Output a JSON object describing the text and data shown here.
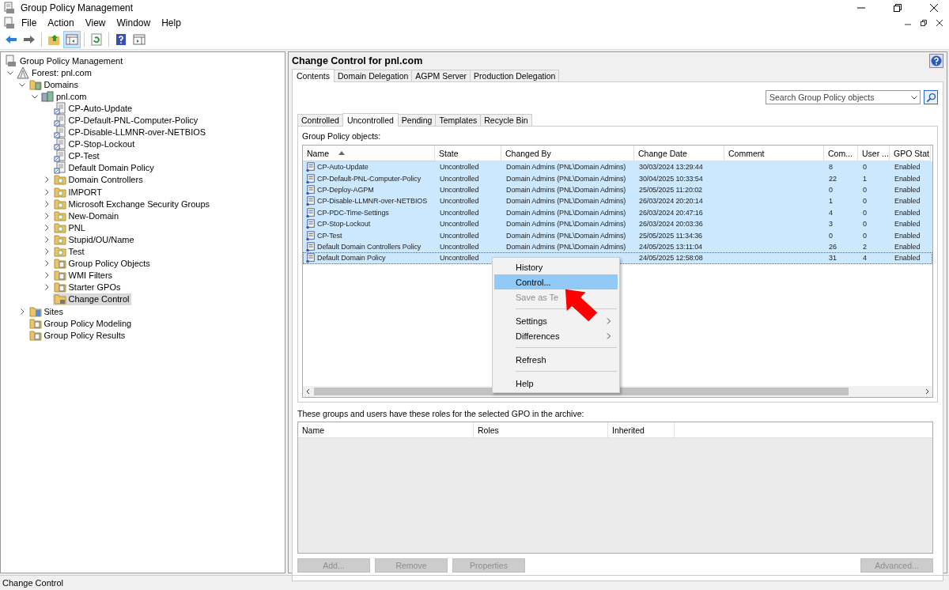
{
  "window": {
    "title": "Group Policy Management"
  },
  "menu": [
    "File",
    "Action",
    "View",
    "Window",
    "Help"
  ],
  "toolbar": [
    {
      "kind": "back",
      "pressed": false
    },
    {
      "kind": "forward",
      "pressed": false
    },
    {
      "kind": "sep"
    },
    {
      "kind": "up",
      "pressed": false
    },
    {
      "kind": "tree",
      "pressed": true
    },
    {
      "kind": "sep"
    },
    {
      "kind": "refresh",
      "pressed": false
    },
    {
      "kind": "sep"
    },
    {
      "kind": "help",
      "pressed": false
    },
    {
      "kind": "pane",
      "pressed": false
    }
  ],
  "tree": [
    {
      "label": "Group Policy Management",
      "kind": "root",
      "selected": false,
      "children": [
        {
          "label": "Forest: pnl.com",
          "kind": "forest",
          "expanded": true,
          "selected": false,
          "children": [
            {
              "label": "Domains",
              "kind": "domains",
              "expanded": true,
              "selected": false,
              "children": [
                {
                  "label": "pnl.com",
                  "kind": "domain",
                  "expanded": true,
                  "selected": false,
                  "children": [
                    {
                      "label": "CP-Auto-Update",
                      "kind": "link",
                      "selected": false
                    },
                    {
                      "label": "CP-Default-PNL-Computer-Policy",
                      "kind": "link",
                      "selected": false
                    },
                    {
                      "label": "CP-Disable-LLMNR-over-NETBIOS",
                      "kind": "link",
                      "selected": false
                    },
                    {
                      "label": "CP-Stop-Lockout",
                      "kind": "link",
                      "selected": false
                    },
                    {
                      "label": "CP-Test",
                      "kind": "link",
                      "selected": false
                    },
                    {
                      "label": "Default Domain Policy",
                      "kind": "link",
                      "selected": false
                    },
                    {
                      "label": "Domain Controllers",
                      "kind": "ou",
                      "expanded": false,
                      "selected": false
                    },
                    {
                      "label": "IMPORT",
                      "kind": "ou",
                      "expanded": false,
                      "selected": false
                    },
                    {
                      "label": "Microsoft Exchange Security Groups",
                      "kind": "ou",
                      "expanded": false,
                      "selected": false
                    },
                    {
                      "label": "New-Domain",
                      "kind": "ou",
                      "expanded": false,
                      "selected": false
                    },
                    {
                      "label": "PNL",
                      "kind": "ou",
                      "expanded": false,
                      "selected": false
                    },
                    {
                      "label": "Stupid/OU/Name",
                      "kind": "ou",
                      "expanded": false,
                      "selected": false
                    },
                    {
                      "label": "Test",
                      "kind": "ou",
                      "expanded": false,
                      "selected": false
                    },
                    {
                      "label": "Group Policy Objects",
                      "kind": "gpos",
                      "expanded": false,
                      "selected": false
                    },
                    {
                      "label": "WMI Filters",
                      "kind": "wmi",
                      "expanded": false,
                      "selected": false
                    },
                    {
                      "label": "Starter GPOs",
                      "kind": "starter",
                      "expanded": false,
                      "selected": false
                    },
                    {
                      "label": "Change Control",
                      "kind": "change",
                      "selected": true
                    }
                  ]
                }
              ]
            },
            {
              "label": "Sites",
              "kind": "sites",
              "expanded": false,
              "selected": false
            },
            {
              "label": "Group Policy Modeling",
              "kind": "modeling",
              "selected": false
            },
            {
              "label": "Group Policy Results",
              "kind": "results",
              "selected": false
            }
          ]
        }
      ]
    }
  ],
  "content": {
    "title": "Change Control for pnl.com",
    "tabs": [
      {
        "label": "Contents",
        "selected": true
      },
      {
        "label": "Domain Delegation",
        "selected": false
      },
      {
        "label": "AGPM Server",
        "selected": false
      },
      {
        "label": "Production Delegation",
        "selected": false
      }
    ],
    "search": {
      "placeholder": "Search Group Policy objects"
    },
    "subtabs": [
      {
        "label": "Controlled",
        "selected": false
      },
      {
        "label": "Uncontrolled",
        "selected": true
      },
      {
        "label": "Pending",
        "selected": false
      },
      {
        "label": "Templates",
        "selected": false
      },
      {
        "label": "Recycle Bin",
        "selected": false
      }
    ],
    "list_label": "Group Policy objects:",
    "table": {
      "columns": [
        {
          "label": "Name",
          "sorted": true
        },
        {
          "label": "State",
          "sorted": false
        },
        {
          "label": "Changed By",
          "sorted": false
        },
        {
          "label": "Change Date",
          "sorted": false
        },
        {
          "label": "Comment",
          "sorted": false
        },
        {
          "label": "Com...",
          "sorted": false
        },
        {
          "label": "User ...",
          "sorted": false
        },
        {
          "label": "GPO Stat",
          "sorted": false
        }
      ],
      "rows": [
        {
          "cells": [
            "CP-Auto-Update",
            "Uncontrolled",
            "Domain Admins (PNL\\Domain Admins)",
            "30/03/2024 13:29:44",
            "",
            "8",
            "0",
            "Enabled"
          ],
          "selected": true,
          "focused": false
        },
        {
          "cells": [
            "CP-Default-PNL-Computer-Policy",
            "Uncontrolled",
            "Domain Admins (PNL\\Domain Admins)",
            "30/04/2025 10:33:54",
            "",
            "22",
            "1",
            "Enabled"
          ],
          "selected": true,
          "focused": false
        },
        {
          "cells": [
            "CP-Deploy-AGPM",
            "Uncontrolled",
            "Domain Admins (PNL\\Domain Admins)",
            "25/05/2025 11:20:02",
            "",
            "0",
            "0",
            "Enabled"
          ],
          "selected": true,
          "focused": false
        },
        {
          "cells": [
            "CP-Disable-LLMNR-over-NETBIOS",
            "Uncontrolled",
            "Domain Admins (PNL\\Domain Admins)",
            "26/03/2024 20:20:14",
            "",
            "1",
            "0",
            "Enabled"
          ],
          "selected": true,
          "focused": false
        },
        {
          "cells": [
            "CP-PDC-Time-Settings",
            "Uncontrolled",
            "Domain Admins (PNL\\Domain Admins)",
            "26/03/2024 20:47:16",
            "",
            "4",
            "0",
            "Enabled"
          ],
          "selected": true,
          "focused": false
        },
        {
          "cells": [
            "CP-Stop-Lockout",
            "Uncontrolled",
            "Domain Admins (PNL\\Domain Admins)",
            "26/03/2024 20:03:36",
            "",
            "3",
            "0",
            "Enabled"
          ],
          "selected": true,
          "focused": false
        },
        {
          "cells": [
            "CP-Test",
            "Uncontrolled",
            "Domain Admins (PNL\\Domain Admins)",
            "25/05/2025 11:34:36",
            "",
            "0",
            "0",
            "Enabled"
          ],
          "selected": true,
          "focused": false
        },
        {
          "cells": [
            "Default Domain Controllers Policy",
            "Uncontrolled",
            "Domain Admins (PNL\\Domain Admins)",
            "24/05/2025 13:11:04",
            "",
            "26",
            "2",
            "Enabled"
          ],
          "selected": true,
          "focused": false
        },
        {
          "cells": [
            "Default Domain Policy",
            "Uncontrolled",
            "",
            "24/05/2025 12:58:08",
            "",
            "31",
            "4",
            "Enabled"
          ],
          "selected": true,
          "focused": true
        }
      ]
    },
    "context_menu": [
      {
        "kind": "item",
        "label": "History",
        "selected": false,
        "disabled": false,
        "submenu": false
      },
      {
        "kind": "item",
        "label": "Control...",
        "selected": true,
        "disabled": false,
        "submenu": false
      },
      {
        "kind": "item",
        "label": "Save as Te",
        "selected": false,
        "disabled": true,
        "submenu": false
      },
      {
        "kind": "separator"
      },
      {
        "kind": "item",
        "label": "Settings",
        "selected": false,
        "disabled": false,
        "submenu": true
      },
      {
        "kind": "item",
        "label": "Differences",
        "selected": false,
        "disabled": false,
        "submenu": true
      },
      {
        "kind": "separator"
      },
      {
        "kind": "item",
        "label": "Refresh",
        "selected": false,
        "disabled": false,
        "submenu": false
      },
      {
        "kind": "separator"
      },
      {
        "kind": "item",
        "label": "Help",
        "selected": false,
        "disabled": false,
        "submenu": false
      }
    ],
    "roles_label": "These groups and users have these roles for the selected GPO in the archive:",
    "roles_table": {
      "columns": [
        "Name",
        "Roles",
        "Inherited"
      ]
    },
    "buttons": [
      {
        "label": "Add...",
        "disabled": true
      },
      {
        "label": "Remove",
        "disabled": true
      },
      {
        "label": "Properties",
        "disabled": true
      },
      {
        "label": "Advanced...",
        "disabled": true
      }
    ]
  },
  "status_bar": "Change Control"
}
